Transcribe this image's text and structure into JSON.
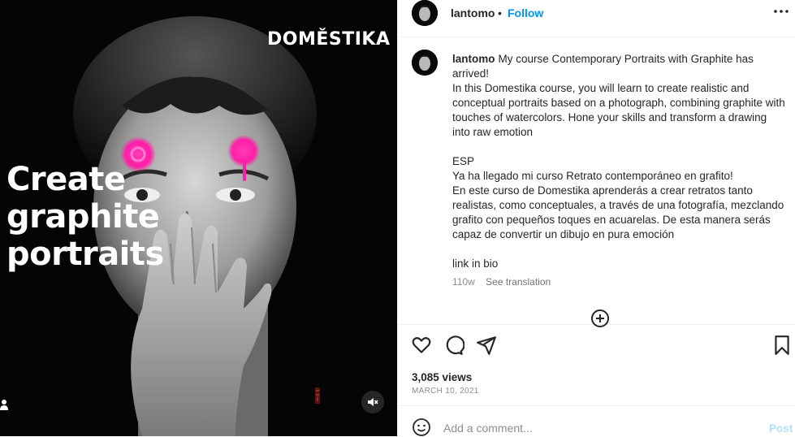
{
  "media": {
    "brand_logo_text": "DOMĚSTIKA",
    "headline_lines": [
      "Create",
      "graphite",
      "portraits"
    ],
    "accent_color": "#ff1ea8",
    "icons": {
      "user_tag": "user-icon",
      "mute": "speaker-muted-icon"
    }
  },
  "header": {
    "username": "lantomo",
    "separator": "•",
    "follow_label": "Follow",
    "more_icon": "more-horizontal-icon"
  },
  "caption": {
    "username": "lantomo",
    "first_line": "My course Contemporary Portraits with Graphite has arrived!",
    "para_en": "In this Domestika course, you will learn to create realistic and conceptual portraits based on a photograph, combining graphite with touches of watercolors. Hone your skills and transform a drawing into raw emotion",
    "lang_tag": "ESP",
    "es_line1": "Ya ha llegado mi curso Retrato contemporáneo en grafito!",
    "para_es": "En este curso de Domestika aprenderás a crear retratos tanto realistas, como conceptuales, a través de una fotografía, mezclando grafito con pequeños toques en acuarelas. De esta manera serás capaz de convertir un dibujo en pura emoción",
    "link_line": "link in bio",
    "age": "110w",
    "see_translation": "See translation",
    "load_more_icon": "plus-circle-icon"
  },
  "actions": {
    "icons": [
      "heart-icon",
      "comment-icon",
      "share-icon",
      "bookmark-icon"
    ]
  },
  "stats": {
    "views": "3,085 views",
    "date": "MARCH 10, 2021"
  },
  "comment": {
    "placeholder": "Add a comment...",
    "post_label": "Post",
    "emoji_icon": "emoji-icon"
  }
}
